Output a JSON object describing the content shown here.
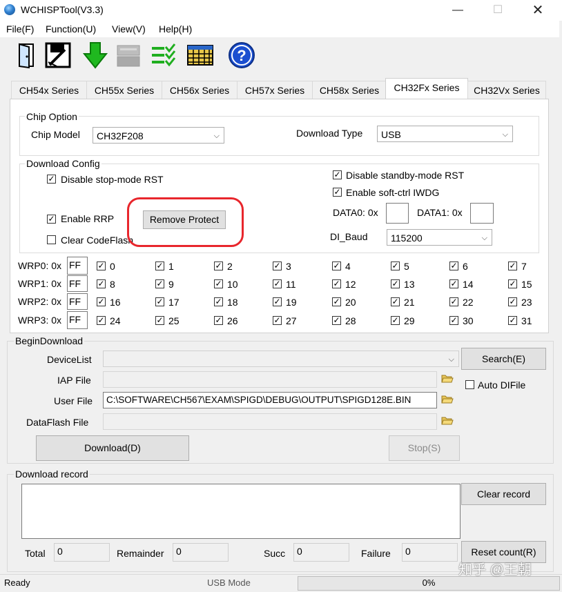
{
  "window": {
    "title": "WCHISPTool(V3.3)"
  },
  "menu": [
    {
      "label": "File(F)"
    },
    {
      "label": "Function(U)"
    },
    {
      "label": "View(V)"
    },
    {
      "label": "Help(H)"
    }
  ],
  "tabs": [
    {
      "label": "CH54x Series"
    },
    {
      "label": "CH55x Series"
    },
    {
      "label": "CH56x Series"
    },
    {
      "label": "CH57x Series"
    },
    {
      "label": "CH58x Series"
    },
    {
      "label": "CH32Fx Series"
    },
    {
      "label": "CH32Vx Series"
    }
  ],
  "chip_option": {
    "group_label": "Chip Option",
    "chip_model_label": "Chip Model",
    "chip_model_value": "CH32F208",
    "download_type_label": "Download Type",
    "download_type_value": "USB"
  },
  "download_config": {
    "group_label": "Download Config",
    "disable_stop_rst": "Disable stop-mode RST",
    "disable_standby_rst": "Disable standby-mode RST",
    "enable_soft_iwdg": "Enable soft-ctrl IWDG",
    "enable_rrp": "Enable RRP",
    "remove_protect": "Remove Protect",
    "clear_codeflash": "Clear CodeFlash",
    "data0_label": "DATA0: 0x",
    "data1_label": "DATA1: 0x",
    "dl_baud_label": "DI_Baud",
    "dl_baud_value": "115200"
  },
  "wrp": [
    {
      "label": "WRP0: 0x",
      "value": "FF",
      "bits": [
        "0",
        "1",
        "2",
        "3",
        "4",
        "5",
        "6",
        "7"
      ]
    },
    {
      "label": "WRP1: 0x",
      "value": "FF",
      "bits": [
        "8",
        "9",
        "10",
        "11",
        "12",
        "13",
        "14",
        "15"
      ]
    },
    {
      "label": "WRP2: 0x",
      "value": "FF",
      "bits": [
        "16",
        "17",
        "18",
        "19",
        "20",
        "21",
        "22",
        "23"
      ]
    },
    {
      "label": "WRP3: 0x",
      "value": "FF",
      "bits": [
        "24",
        "25",
        "26",
        "27",
        "28",
        "29",
        "30",
        "31"
      ]
    }
  ],
  "begin_download": {
    "group_label": "BeginDownload",
    "device_list_label": "DeviceList",
    "search_button": "Search(E)",
    "iap_file_label": "IAP File",
    "auto_difile": "Auto DIFile",
    "user_file_label": "User File",
    "user_file_value": "C:\\SOFTWARE\\CH567\\EXAM\\SPIGD\\DEBUG\\OUTPUT\\SPIGD128E.BIN",
    "dataflash_label": "DataFlash File",
    "download_button": "Download(D)",
    "stop_button": "Stop(S)"
  },
  "download_record": {
    "group_label": "Download record",
    "clear_button": "Clear record",
    "total_label": "Total",
    "total_value": "0",
    "remainder_label": "Remainder",
    "remainder_value": "0",
    "succ_label": "Succ",
    "succ_value": "0",
    "failure_label": "Failure",
    "failure_value": "0",
    "reset_button": "Reset count(R)"
  },
  "status": {
    "ready": "Ready",
    "mode": "USB Mode",
    "progress_text": "0%",
    "progress": 0
  },
  "watermark": "知乎 @王朝",
  "colors": {
    "annotation": "#e8262c",
    "accent_blue": "#1b4fd0"
  }
}
